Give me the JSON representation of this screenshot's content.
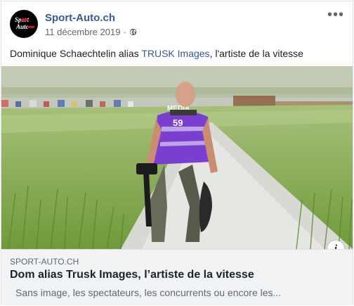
{
  "post": {
    "page_name": "Sport-Auto.ch",
    "date": "11 décembre 2019",
    "dot": "·",
    "privacy_icon": "globe-icon",
    "more_label": "•••",
    "caption_prefix": "Dominique Schaechtelin alias ",
    "caption_link": "TRUSK Images",
    "caption_suffix": ", l'artiste de la vitesse"
  },
  "avatar": {
    "line1": "Sport",
    "line2": "Auto"
  },
  "photo": {
    "vest_text": "MEDIA",
    "vest_number": "59"
  },
  "link_preview": {
    "info_label": "i",
    "domain": "SPORT-AUTO.CH",
    "title": "Dom alias Trusk Images, l’artiste de la vitesse",
    "description": "Sans image, les spectateurs, les concurrents ou encore les..."
  },
  "colors": {
    "link": "#385898",
    "secondary_text": "#606770",
    "preview_bg": "#f2f3f5",
    "vest": "#7a3fd1"
  }
}
